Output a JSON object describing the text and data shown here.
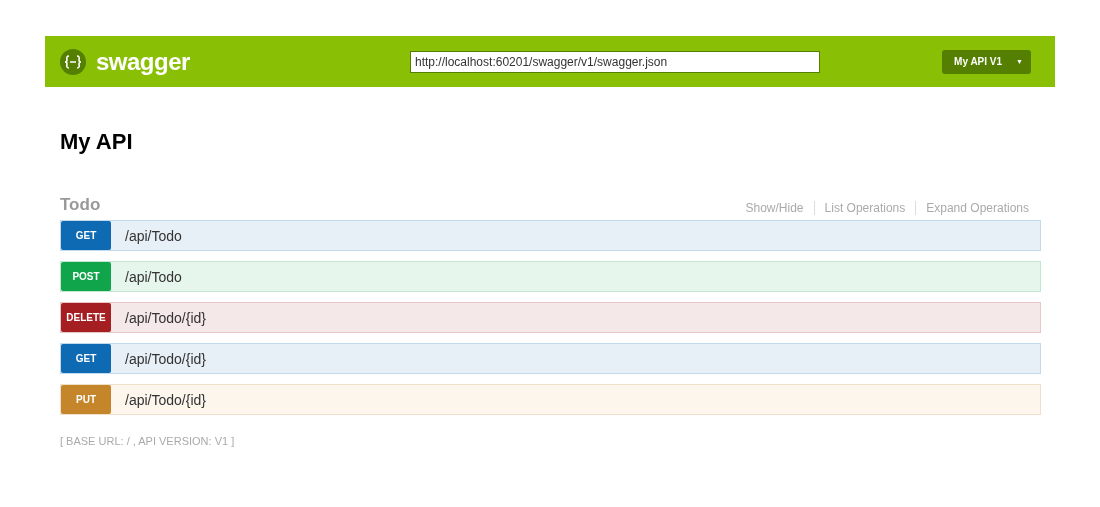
{
  "header": {
    "logo_text": "swagger",
    "url": "http://localhost:60201/swagger/v1/swagger.json",
    "spec_select": "My API V1",
    "caret": "▼"
  },
  "title": "My API",
  "resource": {
    "name": "Todo",
    "links": [
      "Show/Hide",
      "List Operations",
      "Expand Operations"
    ],
    "operations": [
      {
        "kind": "get",
        "method": "GET",
        "path": "/api/Todo"
      },
      {
        "kind": "post",
        "method": "POST",
        "path": "/api/Todo"
      },
      {
        "kind": "delete",
        "method": "DELETE",
        "path": "/api/Todo/{id}"
      },
      {
        "kind": "get",
        "method": "GET",
        "path": "/api/Todo/{id}"
      },
      {
        "kind": "put",
        "method": "PUT",
        "path": "/api/Todo/{id}"
      }
    ]
  },
  "footer": "[ BASE URL: / , API VERSION: V1 ]"
}
